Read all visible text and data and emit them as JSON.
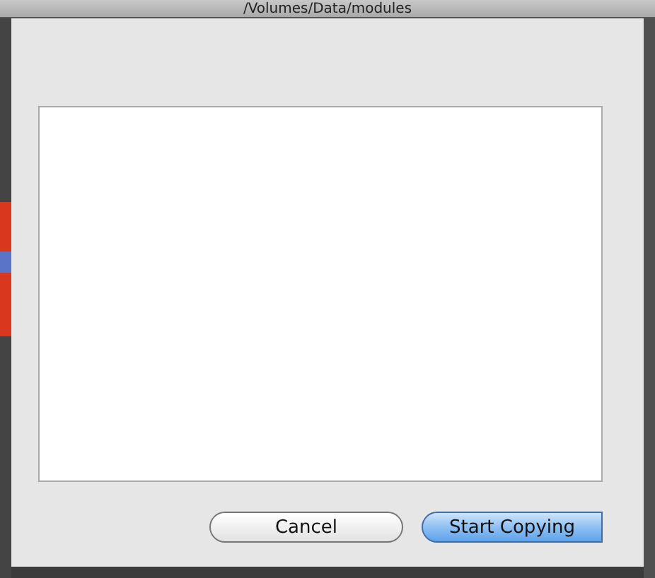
{
  "window": {
    "title": "/Volumes/Data/modules"
  },
  "sheet": {
    "buttons": [
      {
        "label": "Cancel",
        "default": false
      },
      {
        "label": "Start Copying",
        "default": true
      }
    ]
  }
}
